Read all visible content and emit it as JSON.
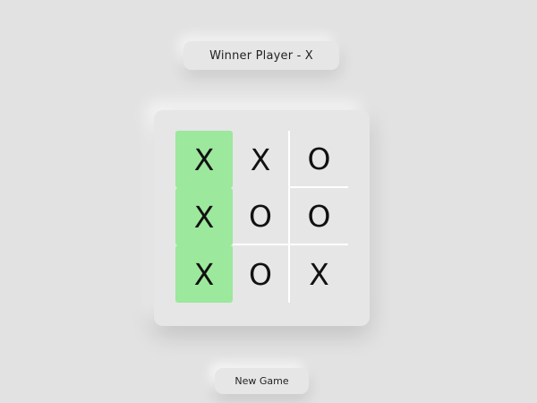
{
  "status": {
    "text": "Winner Player - X"
  },
  "board": {
    "cells": [
      "X",
      "X",
      "O",
      "X",
      "O",
      "O",
      "X",
      "O",
      "X"
    ],
    "winning_cells": [
      0,
      3,
      6
    ],
    "winning_color": "#9ce89c"
  },
  "controls": {
    "new_game_label": "New Game"
  }
}
